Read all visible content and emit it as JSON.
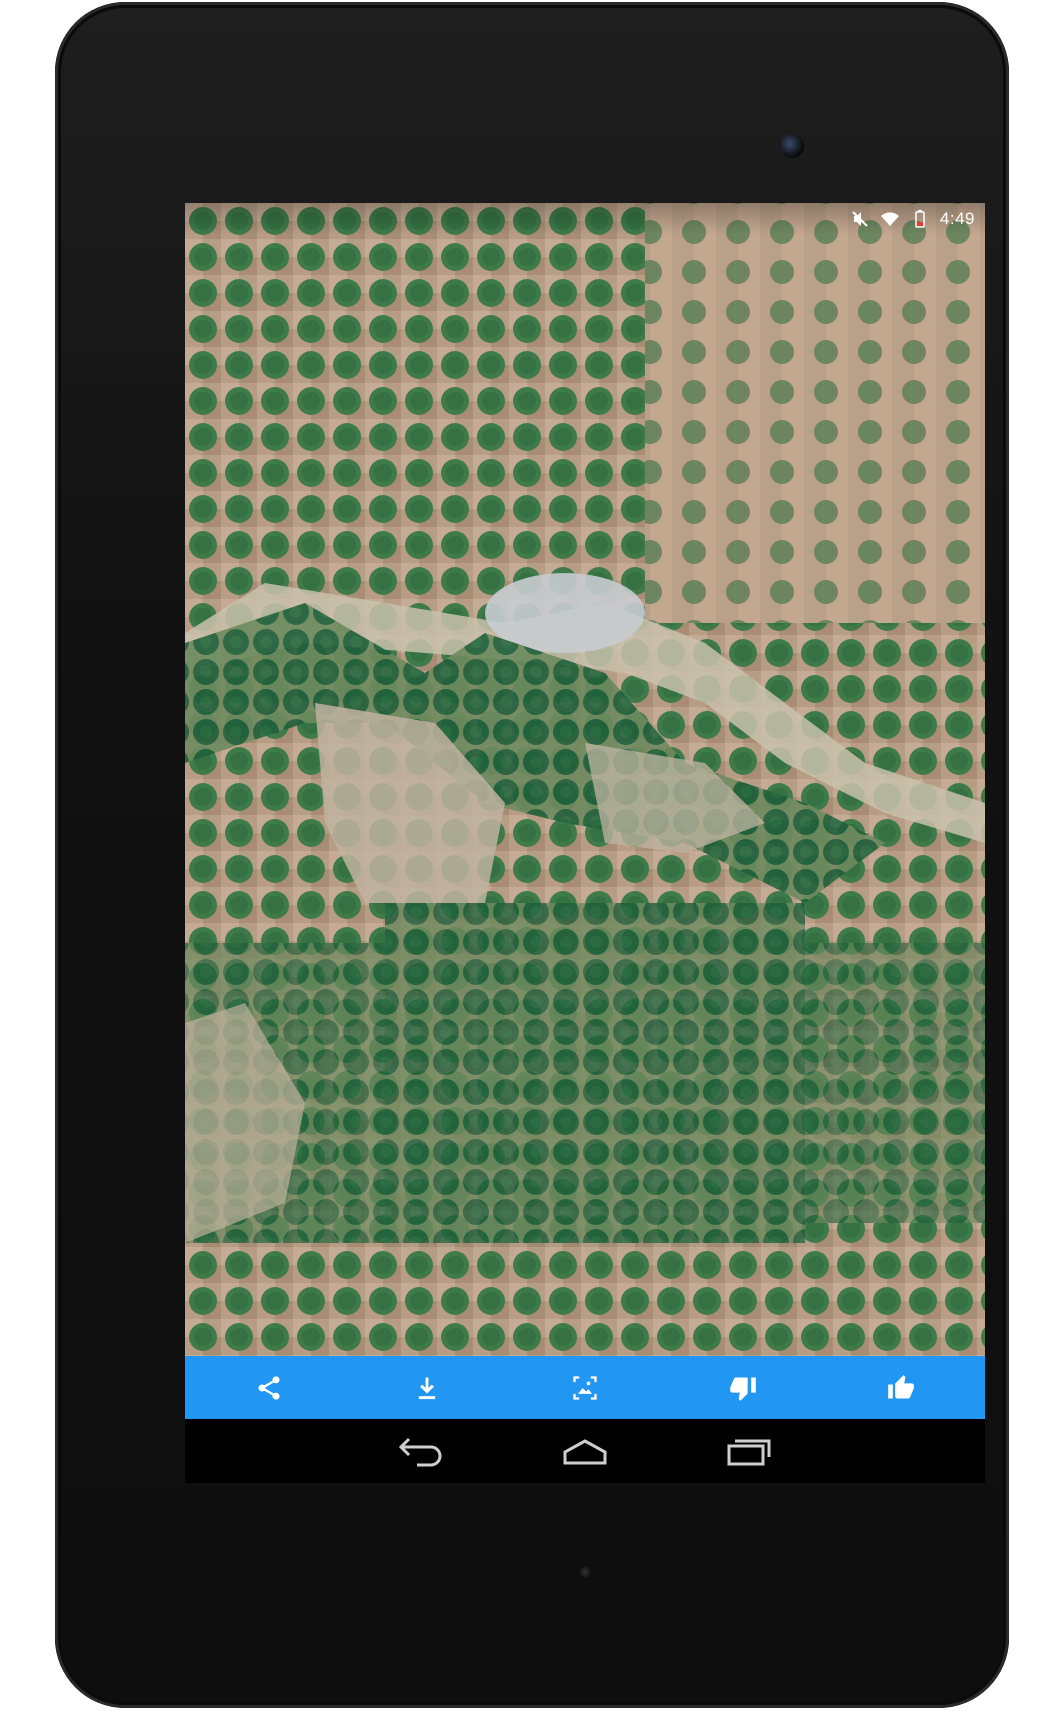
{
  "status_bar": {
    "time": "4:49",
    "icons": [
      "mute-icon",
      "wifi-icon",
      "battery-low-icon"
    ]
  },
  "wallpaper": {
    "description_icon": "satellite-image",
    "colors": {
      "soil": "#b59a82",
      "crop_dark": "#1f5f3a",
      "crop_mid": "#3f7a4a",
      "town": "#c8ccd0"
    }
  },
  "action_bar": {
    "color": "#2196f3",
    "buttons": [
      {
        "icon": "share-icon"
      },
      {
        "icon": "download-icon"
      },
      {
        "icon": "set-wallpaper-icon"
      },
      {
        "icon": "thumbs-down-icon"
      },
      {
        "icon": "thumbs-up-icon"
      }
    ]
  },
  "nav_bar": {
    "buttons": [
      {
        "icon": "back-icon"
      },
      {
        "icon": "home-icon"
      },
      {
        "icon": "recents-icon"
      }
    ]
  }
}
